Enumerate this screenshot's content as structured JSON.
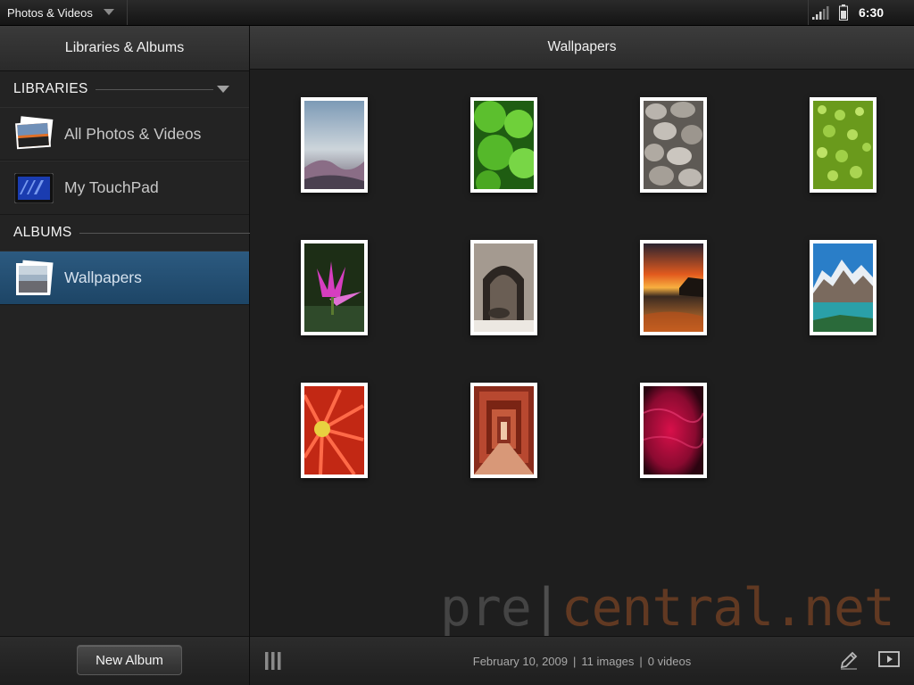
{
  "status_bar": {
    "app_title": "Photos & Videos",
    "clock": "6:30",
    "icons": [
      "chevron-down-icon",
      "signal-icon",
      "battery-icon"
    ]
  },
  "sidebar": {
    "header": "Libraries & Albums",
    "libraries_label": "LIBRARIES",
    "libraries": [
      {
        "label": "All Photos & Videos",
        "icon": "photo-stack-thumb"
      },
      {
        "label": "My TouchPad",
        "icon": "touchpad-thumb"
      }
    ],
    "albums_label": "ALBUMS",
    "albums": [
      {
        "label": "Wallpapers",
        "icon": "album-thumb",
        "selected": true
      }
    ],
    "new_album_label": "New Album"
  },
  "main": {
    "title": "Wallpapers",
    "photos": [
      "mist-lake-photo",
      "green-leaves-photo",
      "pebbles-photo",
      "water-droplets-photo",
      "pink-lotus-photo",
      "stone-arch-photo",
      "sunset-beach-photo",
      "mountain-lake-photo",
      "red-flower-photo",
      "red-corridor-photo",
      "red-texture-photo"
    ],
    "footer": {
      "date": "February 10, 2009",
      "images": "11 images",
      "videos": "0 videos",
      "separator": "|"
    },
    "watermark": {
      "pre": "pre",
      "bar": "|",
      "rest": "central.net"
    }
  },
  "colors": {
    "selection": "#2c5a80",
    "background": "#1e1e1e",
    "watermark_accent": "#b45a28"
  }
}
